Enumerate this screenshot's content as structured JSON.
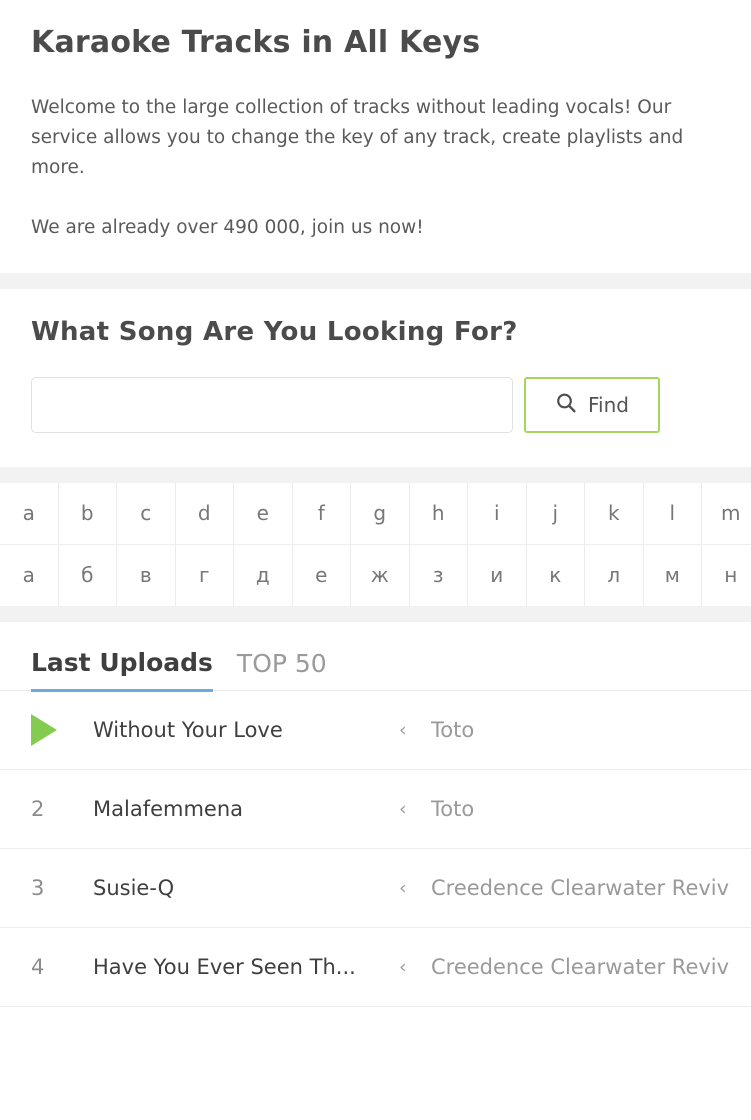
{
  "intro": {
    "title": "Karaoke Tracks in All Keys",
    "paragraph1": "Welcome to the large collection of tracks without leading vocals! Our service allows you to change the key of any track, create playlists and more.",
    "paragraph2": "We are already over 490 000, join us now!"
  },
  "search": {
    "heading": "What Song Are You Looking For?",
    "input_value": "",
    "input_placeholder": "",
    "find_label": "Find",
    "find_icon": "search-icon",
    "button_border_color": "#a5d75b"
  },
  "alphabet": {
    "latin": [
      "a",
      "b",
      "c",
      "d",
      "e",
      "f",
      "g",
      "h",
      "i",
      "j",
      "k",
      "l",
      "m"
    ],
    "cyrillic": [
      "а",
      "б",
      "в",
      "г",
      "д",
      "е",
      "ж",
      "з",
      "и",
      "к",
      "л",
      "м",
      "н"
    ]
  },
  "tabs": [
    {
      "label": "Last Uploads",
      "active": true
    },
    {
      "label": "TOP 50",
      "active": false
    }
  ],
  "tab_accent_color": "#6ca9dd",
  "tracks": [
    {
      "index": "",
      "playing": true,
      "title": "Without Your Love",
      "separator": "‹",
      "artist": "Toto"
    },
    {
      "index": "2",
      "playing": false,
      "title": "Malafemmena",
      "separator": "‹",
      "artist": "Toto"
    },
    {
      "index": "3",
      "playing": false,
      "title": "Susie-Q",
      "separator": "‹",
      "artist": "Creedence Clearwater Reviv"
    },
    {
      "index": "4",
      "playing": false,
      "title": "Have You Ever Seen Th...",
      "separator": "‹",
      "artist": "Creedence Clearwater Reviv"
    }
  ],
  "play_icon_color": "#84cc4f"
}
